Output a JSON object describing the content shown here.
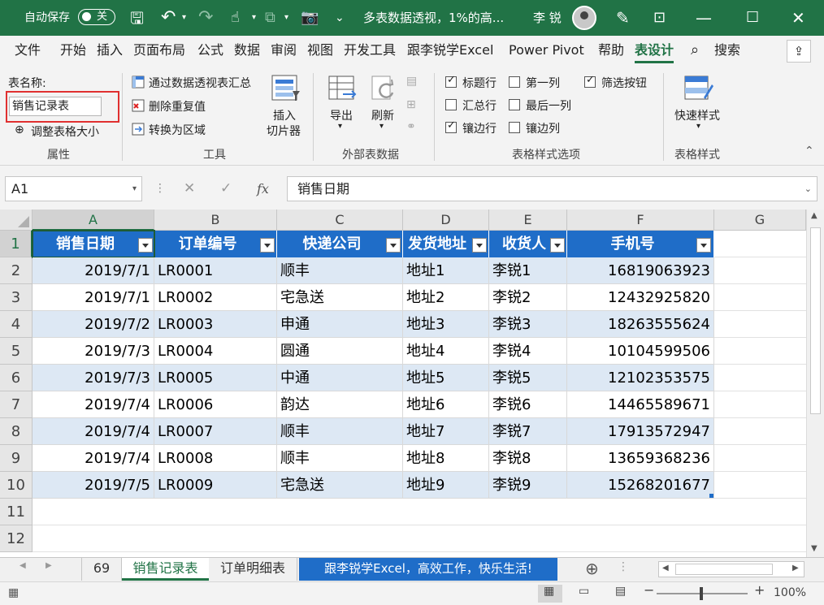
{
  "titlebar": {
    "autosave_label": "自动保存",
    "autosave_state": "关",
    "doc_title": "多表数据透视，1%的高...",
    "user_name": "李 锐"
  },
  "tabs": [
    "文件",
    "开始",
    "插入",
    "页面布局",
    "公式",
    "数据",
    "审阅",
    "视图",
    "开发工具",
    "跟李锐学Excel",
    "Power Pivot",
    "帮助",
    "表设计"
  ],
  "search_label": "搜索",
  "ribbon": {
    "props": {
      "table_name_label": "表名称:",
      "table_name_value": "销售记录表",
      "resize_label": "调整表格大小",
      "group": "属性"
    },
    "tools": {
      "pivot_label": "通过数据透视表汇总",
      "dedupe_label": "删除重复值",
      "convert_label": "转换为区域",
      "slicer_label_1": "插入",
      "slicer_label_2": "切片器",
      "group": "工具"
    },
    "external": {
      "export_label": "导出",
      "refresh_label": "刷新",
      "group": "外部表数据"
    },
    "style_options": {
      "header_row": "标题行",
      "first_col": "第一列",
      "filter_btn": "筛选按钮",
      "total_row": "汇总行",
      "last_col": "最后一列",
      "banded_rows": "镶边行",
      "banded_cols": "镶边列",
      "group": "表格样式选项"
    },
    "styles": {
      "quick_label": "快速样式",
      "group": "表格样式"
    }
  },
  "formula_bar": {
    "cell_ref": "A1",
    "fx": "fx",
    "content": "销售日期"
  },
  "columns": [
    "A",
    "B",
    "C",
    "D",
    "E",
    "F",
    "G"
  ],
  "row_numbers": [
    "1",
    "2",
    "3",
    "4",
    "5",
    "6",
    "7",
    "8",
    "9",
    "10",
    "11",
    "12"
  ],
  "table": {
    "headers": [
      "销售日期",
      "订单编号",
      "快递公司",
      "发货地址",
      "收货人",
      "手机号"
    ],
    "rows": [
      [
        "2019/7/1",
        "LR0001",
        "顺丰",
        "地址1",
        "李锐1",
        "16819063923"
      ],
      [
        "2019/7/1",
        "LR0002",
        "宅急送",
        "地址2",
        "李锐2",
        "12432925820"
      ],
      [
        "2019/7/2",
        "LR0003",
        "申通",
        "地址3",
        "李锐3",
        "18263555624"
      ],
      [
        "2019/7/3",
        "LR0004",
        "圆通",
        "地址4",
        "李锐4",
        "10104599506"
      ],
      [
        "2019/7/3",
        "LR0005",
        "中通",
        "地址5",
        "李锐5",
        "12102353575"
      ],
      [
        "2019/7/4",
        "LR0006",
        "韵达",
        "地址6",
        "李锐6",
        "14465589671"
      ],
      [
        "2019/7/4",
        "LR0007",
        "顺丰",
        "地址7",
        "李锐7",
        "17913572947"
      ],
      [
        "2019/7/4",
        "LR0008",
        "顺丰",
        "地址8",
        "李锐8",
        "13659368236"
      ],
      [
        "2019/7/5",
        "LR0009",
        "宅急送",
        "地址9",
        "李锐9",
        "15268201677"
      ]
    ]
  },
  "sheets": {
    "tab1": "69",
    "tab2": "销售记录表",
    "tab3": "订单明细表",
    "banner": "跟李锐学Excel，高效工作，快乐生活!"
  },
  "status": {
    "zoom": "100%"
  },
  "colors": {
    "excel_green": "#217346",
    "table_header": "#1f6dc8",
    "band": "#dde8f4",
    "highlight_box": "#e03030"
  }
}
